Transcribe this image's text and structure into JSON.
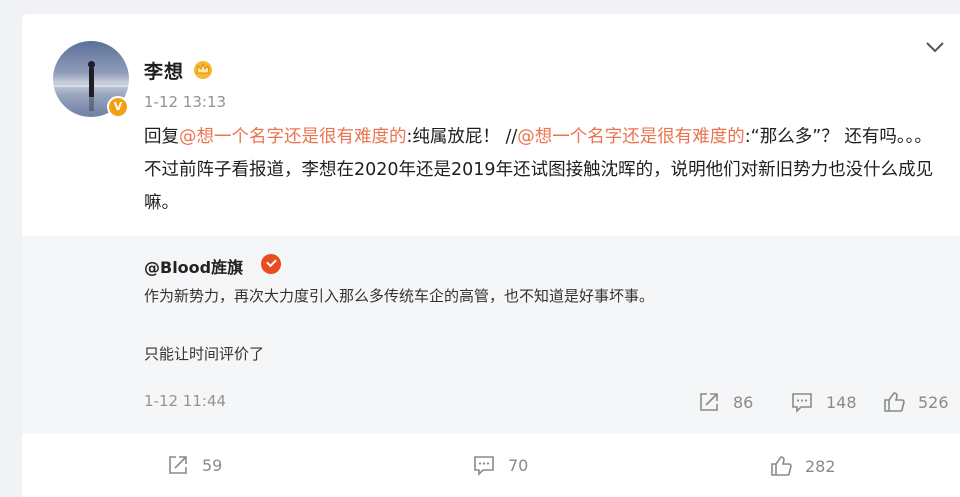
{
  "post": {
    "author": "李想",
    "verified_badge": "V",
    "timestamp": "1-12 13:13",
    "text": {
      "reply_prefix": "回复",
      "mention1": "@想一个名字还是很有难度的",
      "part1": ":纯属放屁！ //",
      "mention2": "@想一个名字还是很有难度的",
      "part2": ":“那么多”？ 还有吗。。。 不过前阵子看报道，李想在2020年还是2019年还试图接触沈晖的，说明他们对新旧势力也没什么成见嘛。"
    },
    "icons": {
      "menu": "chevron-down-icon",
      "member": "crown-icon",
      "avatar": "avatar-photo"
    }
  },
  "repost": {
    "author": "@Blood旌旗",
    "line1": "作为新势力，再次大力度引入那么多传统车企的高管，也不知道是好事坏事。",
    "line2": "只能让时间评价了",
    "timestamp": "1-12 11:44",
    "stats": {
      "reposts": "86",
      "comments": "148",
      "likes": "526"
    }
  },
  "footer": {
    "reposts": "59",
    "comments": "70",
    "likes": "282"
  },
  "colors": {
    "mention": "#eb7350",
    "verified": "#f4a012",
    "orange_badge": "#e94c1e",
    "muted": "#939393"
  }
}
